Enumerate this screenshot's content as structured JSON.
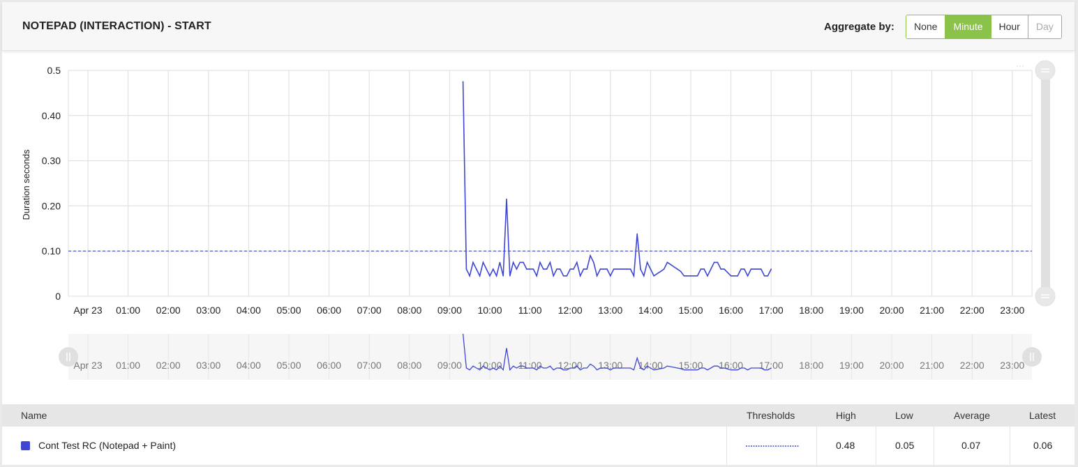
{
  "header": {
    "title": "NOTEPAD (INTERACTION) - START",
    "aggregate_label": "Aggregate by:",
    "aggregate_options": [
      "None",
      "Minute",
      "Hour",
      "Day"
    ],
    "aggregate_selected": "Minute",
    "aggregate_disabled": [
      "Day"
    ]
  },
  "colors": {
    "series": "#3f46d4",
    "threshold": "#3f46d4",
    "accent": "#8bc34a",
    "grid": "#dddddd"
  },
  "chart_data": {
    "type": "line",
    "title": "",
    "xlabel": "",
    "ylabel": "Duration seconds",
    "ylim": [
      0,
      0.5
    ],
    "yticks": [
      0,
      0.1,
      0.2,
      0.3,
      0.4,
      0.5
    ],
    "ytick_labels": [
      "0",
      "0.10",
      "0.20",
      "0.30",
      "0.40",
      "0.5"
    ],
    "xlim": [
      "Apr 23 00:00",
      "Apr 23 23:30"
    ],
    "xtick_labels": [
      "Apr 23",
      "01:00",
      "02:00",
      "03:00",
      "04:00",
      "05:00",
      "06:00",
      "07:00",
      "08:00",
      "09:00",
      "10:00",
      "11:00",
      "12:00",
      "13:00",
      "14:00",
      "15:00",
      "16:00",
      "17:00",
      "18:00",
      "19:00",
      "20:00",
      "21:00",
      "22:00",
      "23:00"
    ],
    "grid": true,
    "threshold": 0.1,
    "series": [
      {
        "name": "Cont Test RC (Notepad + Paint)",
        "x": [
          "09:20",
          "09:25",
          "09:30",
          "09:35",
          "09:40",
          "09:45",
          "09:50",
          "09:55",
          "10:00",
          "10:05",
          "10:10",
          "10:15",
          "10:20",
          "10:25",
          "10:30",
          "10:35",
          "10:40",
          "10:45",
          "10:50",
          "10:55",
          "11:00",
          "11:05",
          "11:10",
          "11:15",
          "11:20",
          "11:25",
          "11:30",
          "11:35",
          "11:40",
          "11:45",
          "11:50",
          "11:55",
          "12:00",
          "12:05",
          "12:10",
          "12:15",
          "12:20",
          "12:25",
          "12:30",
          "12:35",
          "12:40",
          "12:45",
          "12:50",
          "12:55",
          "13:00",
          "13:05",
          "13:10",
          "13:15",
          "13:20",
          "13:25",
          "13:30",
          "13:35",
          "13:40",
          "13:45",
          "13:50",
          "13:55",
          "14:00",
          "14:05",
          "14:10",
          "14:15",
          "14:20",
          "14:25",
          "14:30",
          "14:35",
          "14:40",
          "14:45",
          "14:50",
          "14:55",
          "15:00",
          "15:05",
          "15:10",
          "15:15",
          "15:20",
          "15:25",
          "15:30",
          "15:35",
          "15:40",
          "15:45",
          "15:50",
          "16:00",
          "16:05",
          "16:10",
          "16:15",
          "16:20",
          "16:25",
          "16:30",
          "16:35",
          "16:40",
          "16:45",
          "16:50",
          "16:55",
          "17:00"
        ],
        "values": [
          0.475,
          0.06,
          0.045,
          0.075,
          0.06,
          0.045,
          0.075,
          0.06,
          0.045,
          0.06,
          0.045,
          0.075,
          0.045,
          0.215,
          0.045,
          0.075,
          0.06,
          0.075,
          0.075,
          0.06,
          0.06,
          0.06,
          0.045,
          0.075,
          0.06,
          0.06,
          0.075,
          0.045,
          0.06,
          0.06,
          0.045,
          0.045,
          0.06,
          0.06,
          0.075,
          0.045,
          0.06,
          0.06,
          0.09,
          0.075,
          0.045,
          0.06,
          0.06,
          0.06,
          0.045,
          0.06,
          0.06,
          0.06,
          0.06,
          0.06,
          0.06,
          0.045,
          0.138,
          0.06,
          0.045,
          0.075,
          0.06,
          0.045,
          0.05,
          0.055,
          0.06,
          0.075,
          0.07,
          0.065,
          0.06,
          0.055,
          0.045,
          0.045,
          0.045,
          0.045,
          0.045,
          0.06,
          0.06,
          0.045,
          0.06,
          0.075,
          0.075,
          0.06,
          0.06,
          0.045,
          0.045,
          0.045,
          0.06,
          0.06,
          0.045,
          0.06,
          0.06,
          0.06,
          0.06,
          0.045,
          0.045,
          0.06
        ]
      }
    ],
    "navigator_xtick_labels": [
      "Apr 23",
      "01:00",
      "02:00",
      "03:00",
      "04:00",
      "05:00",
      "06:00",
      "07:00",
      "08:00",
      "09:00",
      "10:00",
      "11:00",
      "12:00",
      "13:00",
      "14:00",
      "15:00",
      "16:00",
      "17:00",
      "18:00",
      "19:00",
      "20:00",
      "21:00",
      "22:00",
      "23:00"
    ]
  },
  "table": {
    "headers": {
      "name": "Name",
      "thresholds": "Thresholds",
      "high": "High",
      "low": "Low",
      "average": "Average",
      "latest": "Latest"
    },
    "rows": [
      {
        "name": "Cont Test RC (Notepad + Paint)",
        "high": "0.48",
        "low": "0.05",
        "average": "0.07",
        "latest": "0.06"
      }
    ]
  }
}
